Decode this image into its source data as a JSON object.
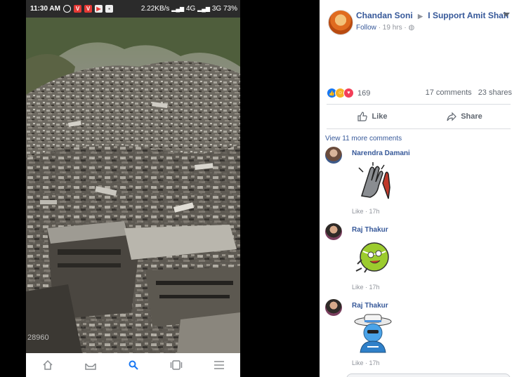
{
  "status_bar": {
    "time": "11:30 AM",
    "speed": "2.22KB/s",
    "network_4g": "4G",
    "network_3g": "3G",
    "battery": "73%"
  },
  "photo": {
    "code": "28960"
  },
  "nav_icons": [
    "home-icon",
    "inbox-icon",
    "search-icon",
    "tabs-icon",
    "menu-icon"
  ],
  "post": {
    "author": "Chandan Soni",
    "group": "I Support Amit Shah",
    "follow": "Follow",
    "time": "19 hrs",
    "reaction_count": "169",
    "comments_count": "17 comments",
    "shares_count": "23 shares",
    "like_label": "Like",
    "share_label": "Share"
  },
  "comments_section": {
    "view_more": "View 11 more comments",
    "comments": [
      {
        "name": "Narendra Damani",
        "like": "Like",
        "time": "17h",
        "sticker": "high-five-sticker"
      },
      {
        "name": "Raj Thakur",
        "like": "Like",
        "time": "17h",
        "sticker": "tennis-ball-sticker"
      },
      {
        "name": "Raj Thakur",
        "like": "Like",
        "time": "17h",
        "sticker": "cowboy-sticker"
      }
    ]
  },
  "colors": {
    "link": "#365899",
    "meta": "#90949c",
    "like_reaction": "#1877f2",
    "haha_reaction": "#f7b125",
    "love_reaction": "#f33e58"
  }
}
